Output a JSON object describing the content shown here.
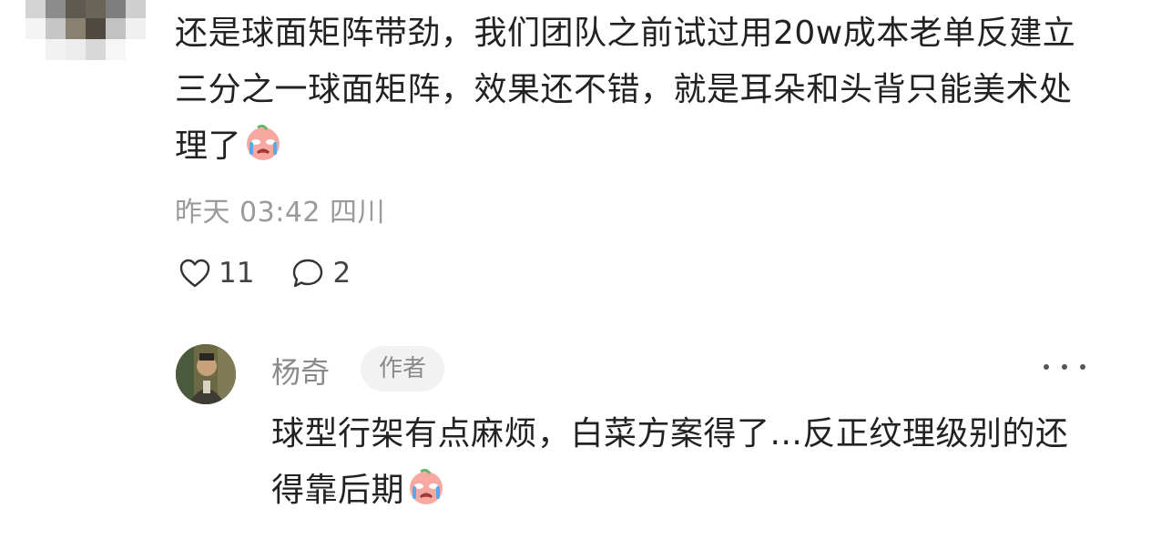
{
  "comment": {
    "text": "还是球面矩阵带劲，我们团队之前试过用20w成本老单反建立三分之一球面矩阵，效果还不错，就是耳朵和头背只能美术处理了",
    "emoji": "crying-face-emoji",
    "time": "昨天 03:42",
    "location": "四川",
    "likes": "11",
    "replies": "2"
  },
  "reply": {
    "author": "杨奇",
    "badge": "作者",
    "text": "球型行架有点麻烦，白菜方案得了...反正纹理级别的还得靠后期",
    "emoji": "crying-face-emoji"
  },
  "icons": {
    "like": "heart-outline-icon",
    "comment": "speech-bubble-icon",
    "more": "more-dots-icon"
  },
  "colors": {
    "text": "#222222",
    "meta": "#9a9a9a",
    "badge_bg": "#f2f2f2"
  }
}
